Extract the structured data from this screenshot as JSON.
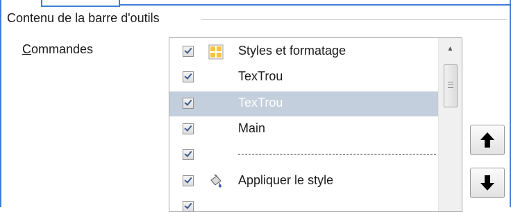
{
  "group": {
    "title": "Contenu de la barre d'outils"
  },
  "commands": {
    "label_mnemonic": "C",
    "label_rest": "ommandes"
  },
  "list": {
    "items": [
      {
        "label": "Styles et formatage",
        "checked": true,
        "icon": "styles-formatting-icon",
        "selected": false,
        "separator": false
      },
      {
        "label": "TexTrou",
        "checked": true,
        "icon": "",
        "selected": false,
        "separator": false
      },
      {
        "label": "TexTrou",
        "checked": true,
        "icon": "",
        "selected": true,
        "separator": false
      },
      {
        "label": "Main",
        "checked": true,
        "icon": "",
        "selected": false,
        "separator": false
      },
      {
        "label": "",
        "checked": true,
        "icon": "",
        "selected": false,
        "separator": true
      },
      {
        "label": "Appliquer le style",
        "checked": true,
        "icon": "paint-bucket-icon",
        "selected": false,
        "separator": false
      },
      {
        "label": "",
        "checked": true,
        "icon": "",
        "selected": false,
        "separator": false
      }
    ]
  },
  "buttons": {
    "up_icon": "arrow-up-icon",
    "down_icon": "arrow-down-icon"
  },
  "colors": {
    "frame_blue": "#3d7bd9",
    "selection": "#c3cfdc"
  }
}
